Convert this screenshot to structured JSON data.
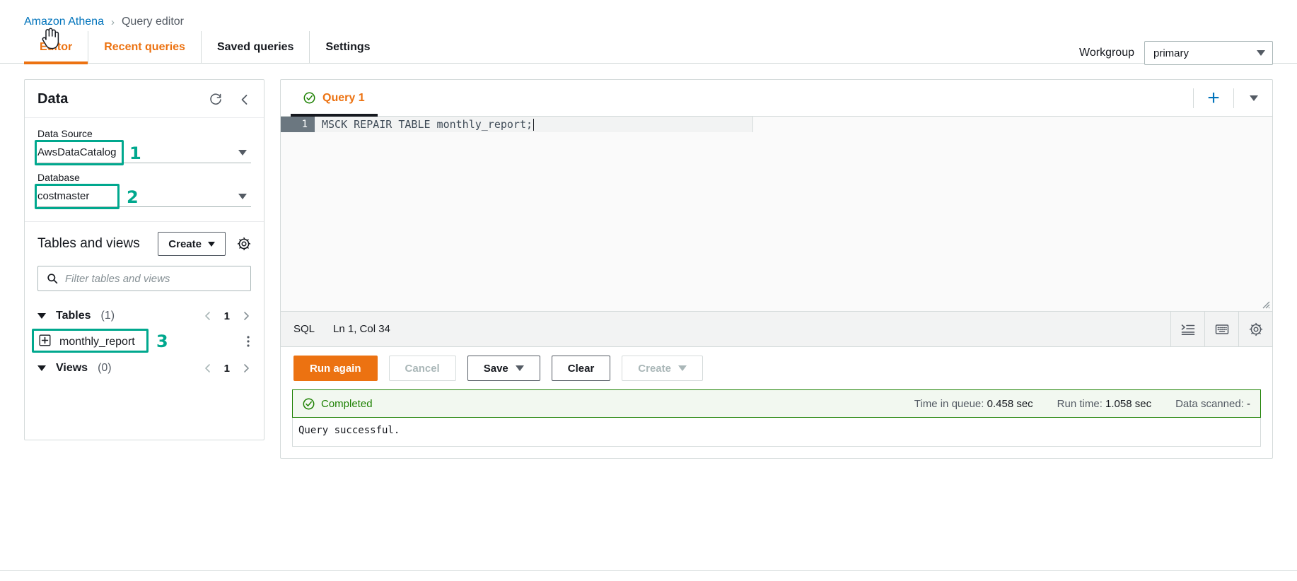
{
  "breadcrumb": {
    "root": "Amazon Athena",
    "separator": "›",
    "current": "Query editor"
  },
  "tabs": [
    {
      "label": "Editor",
      "state": "active"
    },
    {
      "label": "Recent queries",
      "state": "link"
    },
    {
      "label": "Saved queries",
      "state": "normal"
    },
    {
      "label": "Settings",
      "state": "normal"
    }
  ],
  "workgroup": {
    "label": "Workgroup",
    "value": "primary"
  },
  "sidebar": {
    "title": "Data",
    "refresh_icon": "refresh-icon",
    "collapse_icon": "chevron-left-icon",
    "data_source": {
      "label": "Data Source",
      "value": "AwsDataCatalog",
      "annotation": "1"
    },
    "database": {
      "label": "Database",
      "value": "costmaster",
      "annotation": "2"
    },
    "tables_and_views": {
      "title": "Tables and views",
      "create_label": "Create",
      "settings_icon": "gear-icon",
      "filter_placeholder": "Filter tables and views"
    },
    "groups": [
      {
        "name": "Tables",
        "count": "(1)",
        "page": "1"
      },
      {
        "name": "Views",
        "count": "(0)",
        "page": "1"
      }
    ],
    "table_items": [
      {
        "name": "monthly_report",
        "annotation": "3",
        "expand_icon": "plus-box-icon",
        "menu_icon": "kebab-menu-icon"
      }
    ]
  },
  "editor": {
    "query_tabs": [
      {
        "label": "Query 1",
        "status_icon": "check-circle-icon"
      }
    ],
    "add_tab_icon": "plus-icon",
    "tabs_menu_icon": "caret-down-icon",
    "code": {
      "line_number": "1",
      "text": "MSCK REPAIR TABLE monthly_report;"
    },
    "status": {
      "language": "SQL",
      "position": "Ln 1, Col 34",
      "icons": [
        "format-indent-icon",
        "keyboard-icon",
        "gear-icon"
      ]
    },
    "actions": {
      "run": "Run again",
      "cancel": "Cancel",
      "save": "Save",
      "clear": "Clear",
      "create": "Create"
    }
  },
  "result": {
    "status_text": "Completed",
    "status_icon": "check-circle-icon",
    "metrics": [
      {
        "label": "Time in queue:",
        "value": "0.458 sec"
      },
      {
        "label": "Run time:",
        "value": "1.058 sec"
      },
      {
        "label": "Data scanned:",
        "value": "-"
      }
    ],
    "message": "Query successful."
  },
  "colors": {
    "accent_orange": "#ec7211",
    "link_blue": "#0073bb",
    "annotation_green": "#00a88e",
    "success_green": "#1d8102"
  }
}
